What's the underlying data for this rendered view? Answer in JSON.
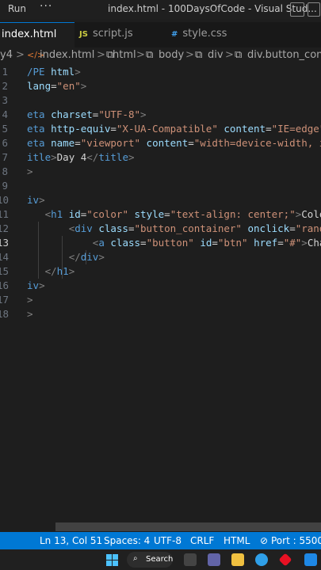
{
  "titlebar": {
    "menu_run": "Run",
    "dots": "···",
    "title": "index.html - 100DaysOfCode - Visual Stud..."
  },
  "tabs": [
    {
      "label": "index.html",
      "icon": "",
      "active": true
    },
    {
      "label": "script.js",
      "icon": "JS",
      "active": false
    },
    {
      "label": "style.css",
      "icon": "#",
      "active": false
    }
  ],
  "breadcrumb": {
    "root": "y4",
    "sep": ">",
    "file": "index.html",
    "items": [
      "html",
      "body",
      "div",
      "div.button_conta"
    ]
  },
  "editor": {
    "lines": [
      {
        "n": "1",
        "tokens": [
          {
            "c": "t-tag",
            "t": "/PE "
          },
          {
            "c": "t-attr",
            "t": "html"
          },
          {
            "c": "t-punc",
            "t": ">"
          }
        ]
      },
      {
        "n": "2",
        "tokens": [
          {
            "c": "t-attr",
            "t": "lang"
          },
          {
            "c": "t-txt",
            "t": "="
          },
          {
            "c": "t-str",
            "t": "\"en\""
          },
          {
            "c": "t-punc",
            "t": ">"
          }
        ]
      },
      {
        "n": "3",
        "tokens": []
      },
      {
        "n": "4",
        "tokens": [
          {
            "c": "t-tag",
            "t": "eta "
          },
          {
            "c": "t-attr",
            "t": "charset"
          },
          {
            "c": "t-txt",
            "t": "="
          },
          {
            "c": "t-str",
            "t": "\"UTF-8\""
          },
          {
            "c": "t-punc",
            "t": ">"
          }
        ]
      },
      {
        "n": "5",
        "tokens": [
          {
            "c": "t-tag",
            "t": "eta "
          },
          {
            "c": "t-attr",
            "t": "http-equiv"
          },
          {
            "c": "t-txt",
            "t": "="
          },
          {
            "c": "t-str",
            "t": "\"X-UA-Compatible\""
          },
          {
            "c": "t-txt",
            "t": " "
          },
          {
            "c": "t-attr",
            "t": "content"
          },
          {
            "c": "t-txt",
            "t": "="
          },
          {
            "c": "t-str",
            "t": "\"IE=edge\""
          }
        ]
      },
      {
        "n": "6",
        "tokens": [
          {
            "c": "t-tag",
            "t": "eta "
          },
          {
            "c": "t-attr",
            "t": "name"
          },
          {
            "c": "t-txt",
            "t": "="
          },
          {
            "c": "t-str",
            "t": "\"viewport\""
          },
          {
            "c": "t-txt",
            "t": " "
          },
          {
            "c": "t-attr",
            "t": "content"
          },
          {
            "c": "t-txt",
            "t": "="
          },
          {
            "c": "t-str",
            "t": "\"width=device-width, i"
          }
        ]
      },
      {
        "n": "7",
        "tokens": [
          {
            "c": "t-tag",
            "t": "itle"
          },
          {
            "c": "t-punc",
            "t": ">"
          },
          {
            "c": "t-txt",
            "t": "Day 4"
          },
          {
            "c": "t-punc",
            "t": "</"
          },
          {
            "c": "t-tag",
            "t": "title"
          },
          {
            "c": "t-punc",
            "t": ">"
          }
        ]
      },
      {
        "n": "8",
        "tokens": [
          {
            "c": "t-punc",
            "t": ">"
          }
        ]
      },
      {
        "n": "9",
        "tokens": []
      },
      {
        "n": "10",
        "tokens": [
          {
            "c": "t-tag",
            "t": "iv"
          },
          {
            "c": "t-punc",
            "t": ">"
          }
        ]
      },
      {
        "n": "11",
        "tokens": [
          {
            "c": "t-txt",
            "t": "   "
          },
          {
            "c": "t-punc",
            "t": "<"
          },
          {
            "c": "t-tag",
            "t": "h1"
          },
          {
            "c": "t-txt",
            "t": " "
          },
          {
            "c": "t-attr",
            "t": "id"
          },
          {
            "c": "t-txt",
            "t": "="
          },
          {
            "c": "t-str",
            "t": "\"color\""
          },
          {
            "c": "t-txt",
            "t": " "
          },
          {
            "c": "t-attr",
            "t": "style"
          },
          {
            "c": "t-txt",
            "t": "="
          },
          {
            "c": "t-str",
            "t": "\"text-align: center;\""
          },
          {
            "c": "t-punc",
            "t": ">"
          },
          {
            "c": "t-txt",
            "t": "Colo"
          }
        ]
      },
      {
        "n": "12",
        "tokens": [
          {
            "c": "t-txt",
            "t": "       "
          },
          {
            "c": "t-punc",
            "t": "<"
          },
          {
            "c": "t-tag",
            "t": "div"
          },
          {
            "c": "t-txt",
            "t": " "
          },
          {
            "c": "t-attr",
            "t": "class"
          },
          {
            "c": "t-txt",
            "t": "="
          },
          {
            "c": "t-str",
            "t": "\"button_container\""
          },
          {
            "c": "t-txt",
            "t": " "
          },
          {
            "c": "t-attr",
            "t": "onclick"
          },
          {
            "c": "t-txt",
            "t": "="
          },
          {
            "c": "t-str",
            "t": "\"rando"
          }
        ]
      },
      {
        "n": "13",
        "tokens": [
          {
            "c": "t-txt",
            "t": "           "
          },
          {
            "c": "t-punc",
            "t": "<"
          },
          {
            "c": "t-tag",
            "t": "a"
          },
          {
            "c": "t-txt",
            "t": " "
          },
          {
            "c": "t-attr",
            "t": "class"
          },
          {
            "c": "t-txt",
            "t": "="
          },
          {
            "c": "t-str",
            "t": "\"button\""
          },
          {
            "c": "t-txt",
            "t": " "
          },
          {
            "c": "t-attr",
            "t": "id"
          },
          {
            "c": "t-txt",
            "t": "="
          },
          {
            "c": "t-str",
            "t": "\"btn\""
          },
          {
            "c": "t-txt",
            "t": " "
          },
          {
            "c": "t-attr",
            "t": "href"
          },
          {
            "c": "t-txt",
            "t": "="
          },
          {
            "c": "t-str",
            "t": "\"#\""
          },
          {
            "c": "t-punc",
            "t": ">"
          },
          {
            "c": "t-txt",
            "t": "Chan"
          }
        ]
      },
      {
        "n": "14",
        "tokens": [
          {
            "c": "t-txt",
            "t": "       "
          },
          {
            "c": "t-punc",
            "t": "</"
          },
          {
            "c": "t-tag",
            "t": "div"
          },
          {
            "c": "t-punc",
            "t": ">"
          }
        ]
      },
      {
        "n": "15",
        "tokens": [
          {
            "c": "t-txt",
            "t": "   "
          },
          {
            "c": "t-punc",
            "t": "</"
          },
          {
            "c": "t-tag",
            "t": "h1"
          },
          {
            "c": "t-punc",
            "t": ">"
          }
        ]
      },
      {
        "n": "16",
        "tokens": [
          {
            "c": "t-tag",
            "t": "iv"
          },
          {
            "c": "t-punc",
            "t": ">"
          }
        ]
      },
      {
        "n": "17",
        "tokens": [
          {
            "c": "t-punc",
            "t": ">"
          }
        ]
      },
      {
        "n": "18",
        "tokens": [
          {
            "c": "t-punc",
            "t": ">"
          }
        ]
      }
    ],
    "current_line": "13"
  },
  "statusbar": {
    "position": "Ln 13, Col 51",
    "spaces": "Spaces: 4",
    "encoding": "UTF-8",
    "eol": "CRLF",
    "language": "HTML",
    "port": "Port : 5500"
  },
  "taskbar": {
    "search_label": "Search"
  },
  "colors": {
    "status_bg": "#0078d4",
    "editor_bg": "#1e1e1e",
    "tag": "#569cd6",
    "attr": "#9cdcfe",
    "string": "#ce9178"
  }
}
